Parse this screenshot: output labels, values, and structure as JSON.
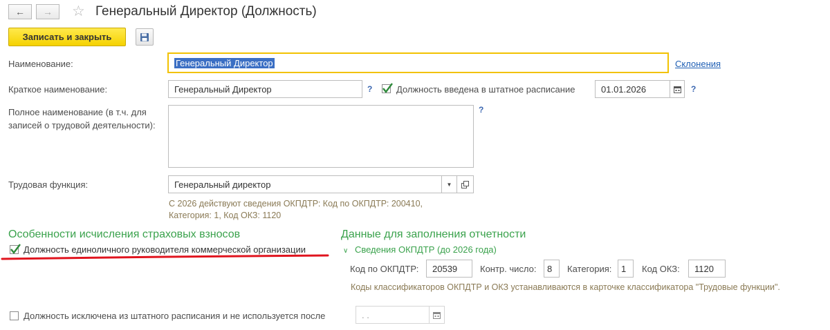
{
  "window": {
    "title": "Генеральный Директор (Должность)"
  },
  "toolbar": {
    "save_close_label": "Записать и закрыть"
  },
  "form": {
    "name_label": "Наименование:",
    "name_value": "Генеральный Директор",
    "declensions_link": "Склонения",
    "short_name_label": "Краткое наименование:",
    "short_name_value": "Генеральный Директор",
    "help_mark": "?",
    "staffing_checkbox_label": "Должность введена в штатное расписание",
    "staffing_checked": true,
    "staffing_date": "01.01.2026",
    "full_name_label_line1": "Полное наименование (в т.ч. для",
    "full_name_label_line2": "записей о трудовой деятельности):",
    "full_name_value": "",
    "labor_function_label": "Трудовая функция:",
    "labor_function_value": "Генеральный директор",
    "okpdtr_hint_line1": "С 2026 действуют сведения ОКПДТР: Код по ОКПДТР: 200410,",
    "okpdtr_hint_line2": "Категория: 1, Код ОКЗ: 1120"
  },
  "insurance": {
    "section_title": "Особенности исчисления страховых взносов",
    "sole_manager_label": "Должность единоличного руководителя коммерческой организации",
    "sole_manager_checked": true
  },
  "reporting": {
    "section_title": "Данные для заполнения отчетности",
    "collapsible_title": "Сведения ОКПДТР (до 2026 года)",
    "okpdtr_code_label": "Код по ОКПДТР:",
    "okpdtr_code_value": "20539",
    "check_number_label": "Контр. число:",
    "check_number_value": "8",
    "category_label": "Категория:",
    "category_value": "1",
    "okz_code_label": "Код ОКЗ:",
    "okz_code_value": "1120",
    "classifier_hint": "Коды классификаторов ОКПДТР и ОКЗ устанавливаются в карточке классификатора \"Трудовые функции\"."
  },
  "excluded": {
    "checkbox_label": "Должность исключена из штатного расписания и не используется после",
    "checked": false,
    "date_placeholder": ". ."
  },
  "colors": {
    "accent_yellow": "#f5d200",
    "section_green": "#3aa24c",
    "link_blue": "#1f5fb4",
    "annotation_red": "#e0141e"
  }
}
